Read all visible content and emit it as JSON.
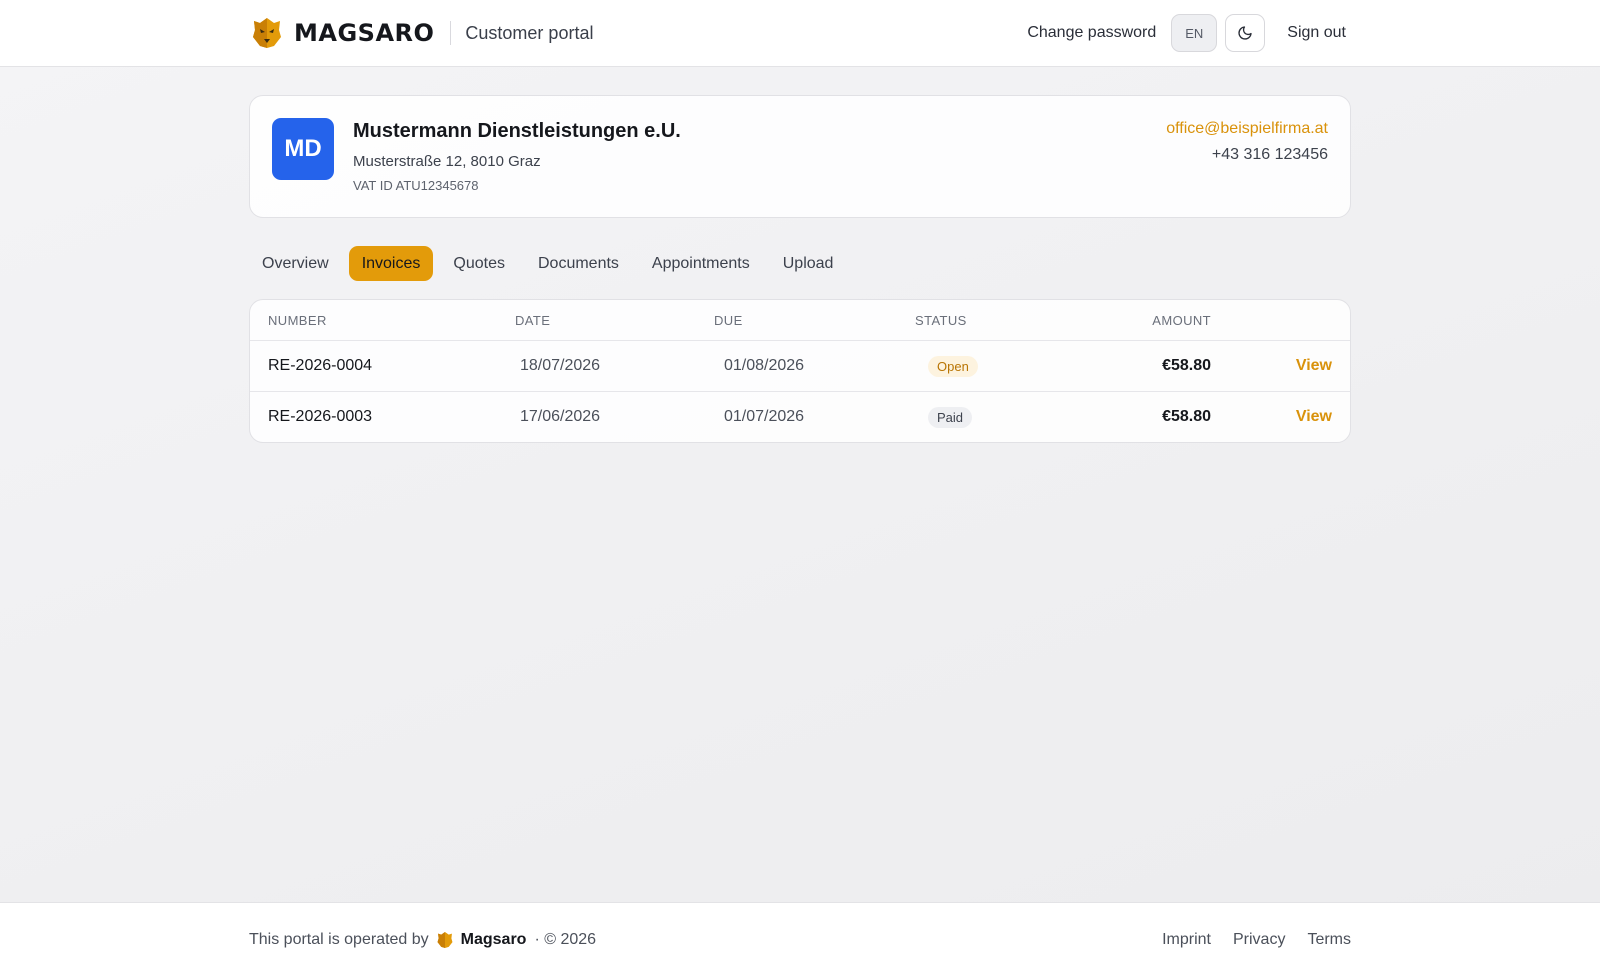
{
  "header": {
    "brand_name": "MAGSARO",
    "portal_title": "Customer portal",
    "change_password": "Change password",
    "language": "EN",
    "theme_icon": "moon-icon",
    "sign_out": "Sign out"
  },
  "customer": {
    "initials": "MD",
    "name": "Mustermann Dienstleistungen e.U.",
    "address": "Musterstraße 12, 8010 Graz",
    "vat": "VAT ID ATU12345678",
    "email": "office@beispielfirma.at",
    "phone": "+43 316 123456",
    "avatar_color": "#2563eb"
  },
  "tabs": [
    {
      "label": "Overview",
      "active": false
    },
    {
      "label": "Invoices",
      "active": true
    },
    {
      "label": "Quotes",
      "active": false
    },
    {
      "label": "Documents",
      "active": false
    },
    {
      "label": "Appointments",
      "active": false
    },
    {
      "label": "Upload",
      "active": false
    }
  ],
  "invoices": {
    "columns": [
      "NUMBER",
      "DATE",
      "DUE",
      "STATUS",
      "AMOUNT"
    ],
    "rows": [
      {
        "number": "RE-2026-0004",
        "date": "18/07/2026",
        "due": "01/08/2026",
        "status": "Open",
        "amount": "€58.80",
        "action": "View"
      },
      {
        "number": "RE-2026-0003",
        "date": "17/06/2026",
        "due": "01/07/2026",
        "status": "Paid",
        "amount": "€58.80",
        "action": "View"
      }
    ]
  },
  "footer": {
    "operated_by": "This portal is operated by",
    "brand": "Magsaro",
    "copyright": "· © 2026",
    "links": [
      "Imprint",
      "Privacy",
      "Terms"
    ]
  },
  "colors": {
    "accent": "#e39b0a",
    "link": "#d9920b",
    "avatar": "#2563eb"
  }
}
